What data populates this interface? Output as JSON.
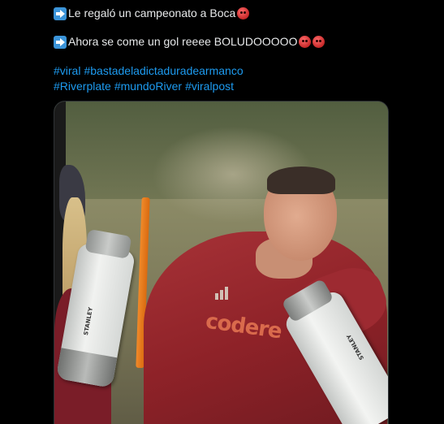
{
  "tweet": {
    "line1_text": "Le regaló un campeonato a Boca",
    "line1_emoji_count": 1,
    "line2_text": "Ahora se come un gol reeee BOLUDOOOOO",
    "line2_emoji_count": 2,
    "hashtags_row1": [
      "#viral",
      "#bastadeladictaduradearmanco"
    ],
    "hashtags_row2": [
      "#Riverplate",
      "#mundoRiver",
      "#viralpost"
    ]
  },
  "media": {
    "sponsor_text": "codere",
    "thermos_brand": "STANLEY"
  },
  "colors": {
    "background": "#000000",
    "text": "#e7e9ea",
    "link": "#1d9bf0",
    "shirt": "#a73237"
  },
  "icons": [
    "arrow-right-emoji",
    "angry-face-emoji"
  ]
}
